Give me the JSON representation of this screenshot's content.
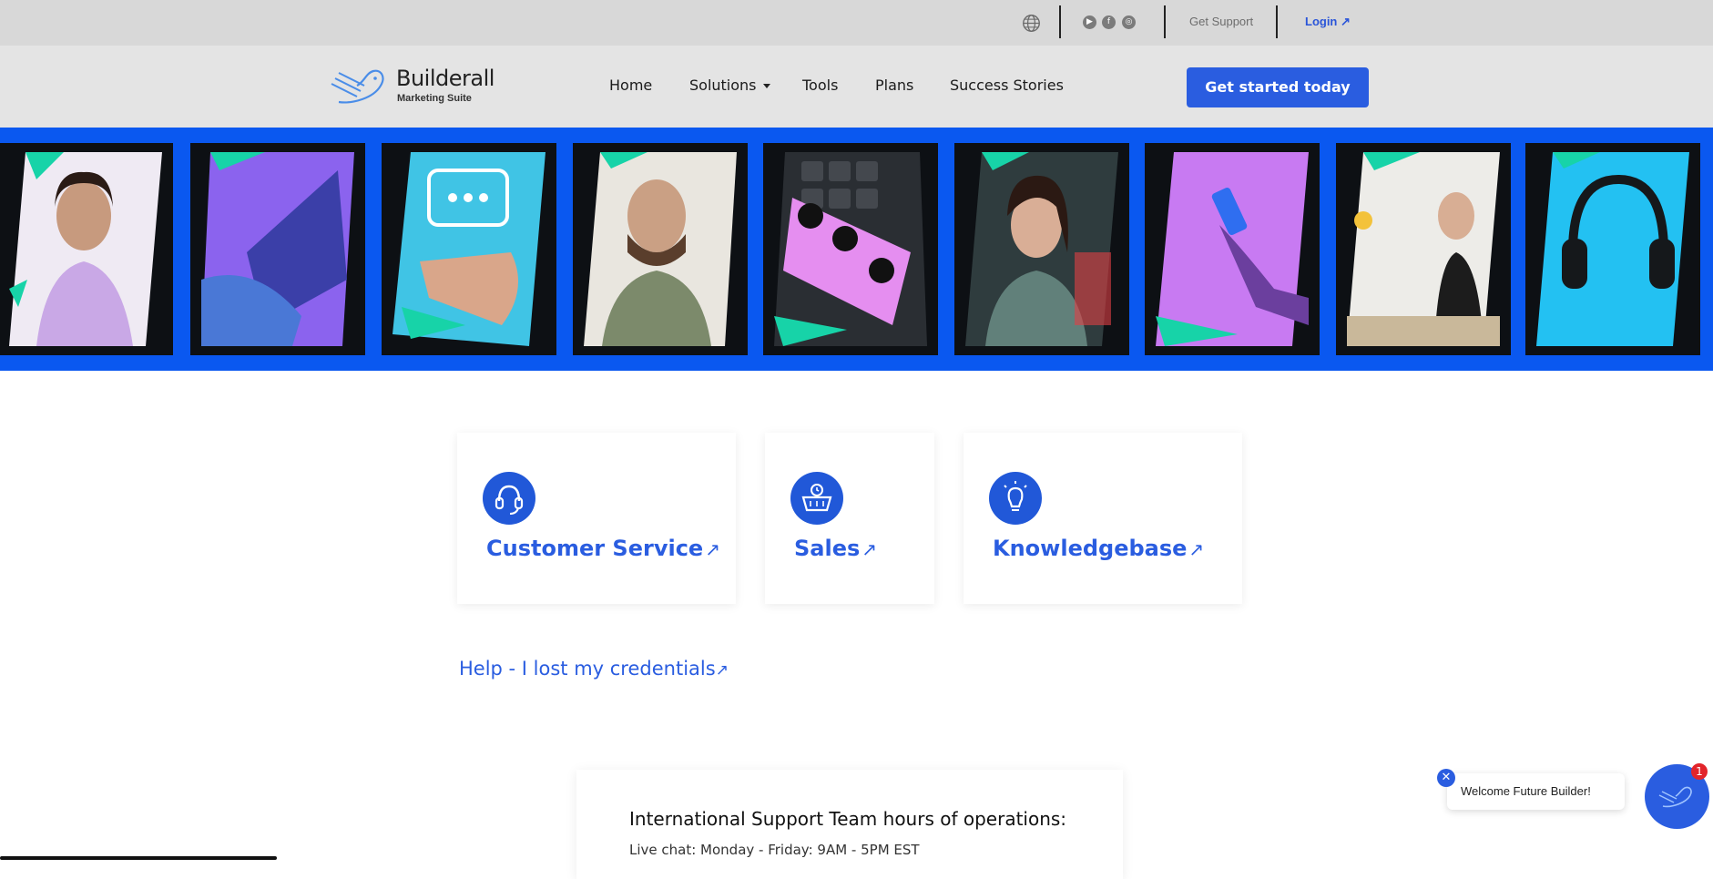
{
  "topbar": {
    "globe_icon": "globe-icon",
    "social": [
      "youtube-icon",
      "facebook-icon",
      "instagram-icon"
    ],
    "get_support": "Get Support",
    "login": "Login ↗"
  },
  "brand": {
    "name": "Builderall",
    "tagline": "Marketing Suite",
    "color": "#2a5de0"
  },
  "nav": {
    "items": [
      "Home",
      "Solutions",
      "Tools",
      "Plans",
      "Success Stories"
    ],
    "cta": "Get started today"
  },
  "hero": {
    "background": "#0a58f0",
    "panels": [
      {
        "subject": "woman with headset",
        "color": "#e9e4ee"
      },
      {
        "subject": "typing on laptop",
        "color": "#9a6cf5"
      },
      {
        "subject": "hand with chat bubble",
        "color": "#3ec6e6"
      },
      {
        "subject": "man with headset",
        "color": "#e6e3dc"
      },
      {
        "subject": "keyboard with emoji keys",
        "color": "#2b2f33"
      },
      {
        "subject": "woman with headset",
        "color": "#3b4a4a"
      },
      {
        "subject": "hand holding phone",
        "color": "#c77df3"
      },
      {
        "subject": "woman waving at laptop",
        "color": "#ecebe8"
      },
      {
        "subject": "headphones",
        "color": "#23c1f2"
      }
    ]
  },
  "cards": [
    {
      "title": "Customer Service",
      "icon": "headset-icon"
    },
    {
      "title": "Sales",
      "icon": "basket-clock-icon"
    },
    {
      "title": "Knowledgebase",
      "icon": "lightbulb-icon"
    }
  ],
  "lost_credentials": "Help - I lost my credentials",
  "hours": {
    "title": "International Support Team hours of operations:",
    "line": "Live chat: Monday - Friday: 9AM - 5PM EST"
  },
  "chat": {
    "message": "Welcome Future Builder!",
    "badge_count": "1",
    "close": "✕"
  }
}
